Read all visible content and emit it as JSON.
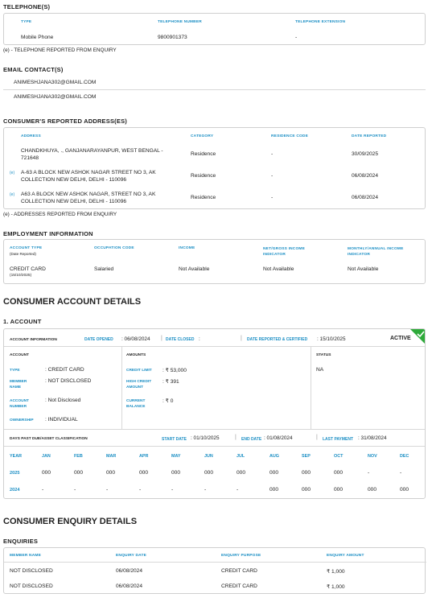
{
  "telephone": {
    "title": "TELEPHONE(S)",
    "headers": [
      "TYPE",
      "TELEPHONE NUMBER",
      "TELEPHONE EXTENSION"
    ],
    "row": [
      "Mobile Phone",
      "9800901373",
      "-"
    ],
    "note": "(e) - TELEPHONE REPORTED FROM ENQUIRY"
  },
  "email": {
    "title": "EMAIL CONTACT(S)",
    "items": [
      "ANIMESHJANA302@GMAIL.COM",
      "ANIMESHJANA302@GMAIL.COM"
    ]
  },
  "address": {
    "title": "CONSUMER'S REPORTED ADDRESS(ES)",
    "headers": [
      "ADDRESS",
      "CATEGORY",
      "RESIDENCE CODE",
      "DATE REPORTED"
    ],
    "rows": [
      {
        "tag": "",
        "address": "CHANDKHUYA, ., GANJANARAYANPUR, WEST BENGAL - 721648",
        "category": "Residence",
        "code": "-",
        "date": "30/09/2025"
      },
      {
        "tag": "(e)",
        "address": "A-63 A BLOCK NEW ASHOK NAGAR STREET NO 3, AK COLLECTION NEW DELHI, DELHI - 110096",
        "category": "Residence",
        "code": "-",
        "date": "06/08/2024"
      },
      {
        "tag": "(e)",
        "address": "A63 A BLOCK NEW ASHOK NAGAR, STREET NO 3, AK COLLECTION NEW DELHI, DELHI - 110096",
        "category": "Residence",
        "code": "-",
        "date": "06/08/2024"
      }
    ],
    "note": "(e) - ADDRESSES REPORTED FROM ENQUIRY"
  },
  "employment": {
    "title": "EMPLOYMENT INFORMATION",
    "h_account_type": "ACCOUNT TYPE",
    "h_date_reported": "(Date Reported)",
    "h_occupation": "OCCUPATION CODE",
    "h_income": "INCOME",
    "h_net_gross": "NET/GROSS INCOME INDICATOR",
    "h_monthly": "MONTHLY/ANNUAL INCOME INDICATOR",
    "account_type": "CREDIT CARD",
    "date": "(15/10/2025)",
    "occupation": "Salaried",
    "income": "Not Available",
    "net_gross": "Not Available",
    "monthly": "Not Available"
  },
  "account_details": {
    "title": "CONSUMER ACCOUNT DETAILS",
    "sub": "1. ACCOUNT",
    "info_label": "ACCOUNT INFORMATION",
    "date_opened_label": "DATE OPENED",
    "date_opened": ": 06/08/2024",
    "date_closed_label": "DATE CLOSED",
    "date_closed": ":",
    "date_reported_label": "DATE REPORTED & CERTIFIED",
    "date_reported": ": 15/10/2025",
    "status_badge": "ACTIVE",
    "col_account": "ACCOUNT",
    "col_amounts": "AMOUNTS",
    "col_status": "STATUS",
    "type_label": "TYPE",
    "type_value": ": CREDIT CARD",
    "member_label": "MEMBER NAME",
    "member_value": ": NOT DISCLOSED",
    "accnum_label": "ACCOUNT NUMBER",
    "accnum_value": ": Not Disclosed",
    "ownership_label": "OWNERSHIP",
    "ownership_value": ": INDIVIDUAL",
    "credit_limit_label": "CREDIT LIMIT",
    "credit_limit_value": ": ₹ 53,000",
    "high_credit_label": "HIGH CREDIT AMOUNT",
    "high_credit_value": ": ₹ 391",
    "current_balance_label": "CURRENT BALANCE",
    "current_balance_value": ": ₹ 0",
    "status_value": "NA",
    "dpd_label": "DAYS PAST DUE/ASSET CLASSIFICATION",
    "start_label": "START DATE",
    "start_value": ": 01/10/2025",
    "end_label": "END DATE",
    "end_value": ": 01/08/2024",
    "last_payment_label": "LAST PAYMENT",
    "last_payment_value": ": 31/08/2024",
    "year_header": "YEAR",
    "months": [
      "JAN",
      "FEB",
      "MAR",
      "APR",
      "MAY",
      "JUN",
      "JUL",
      "AUG",
      "SEP",
      "OCT",
      "NOV",
      "DEC"
    ],
    "rows": [
      {
        "year": "2025",
        "values": [
          "000",
          "000",
          "000",
          "000",
          "000",
          "000",
          "000",
          "000",
          "000",
          "000",
          "-",
          "-"
        ]
      },
      {
        "year": "2024",
        "values": [
          "-",
          "-",
          "-",
          "-",
          "-",
          "-",
          "-",
          "000",
          "000",
          "000",
          "000",
          "000"
        ]
      }
    ]
  },
  "enquiry": {
    "title": "CONSUMER ENQUIRY DETAILS",
    "sub": "ENQUIRIES",
    "headers": [
      "MEMBER NAME",
      "ENQUIRY DATE",
      "ENQUIRY PURPOSE",
      "ENQUIRY AMOUNT"
    ],
    "rows": [
      [
        "NOT DISCLOSED",
        "06/08/2024",
        "CREDIT CARD",
        "₹ 1,000"
      ],
      [
        "NOT DISCLOSED",
        "06/08/2024",
        "CREDIT CARD",
        "₹ 1,000"
      ]
    ]
  },
  "colors": {
    "accent": "#1a8ec4",
    "badge": "#2eaa3a"
  }
}
